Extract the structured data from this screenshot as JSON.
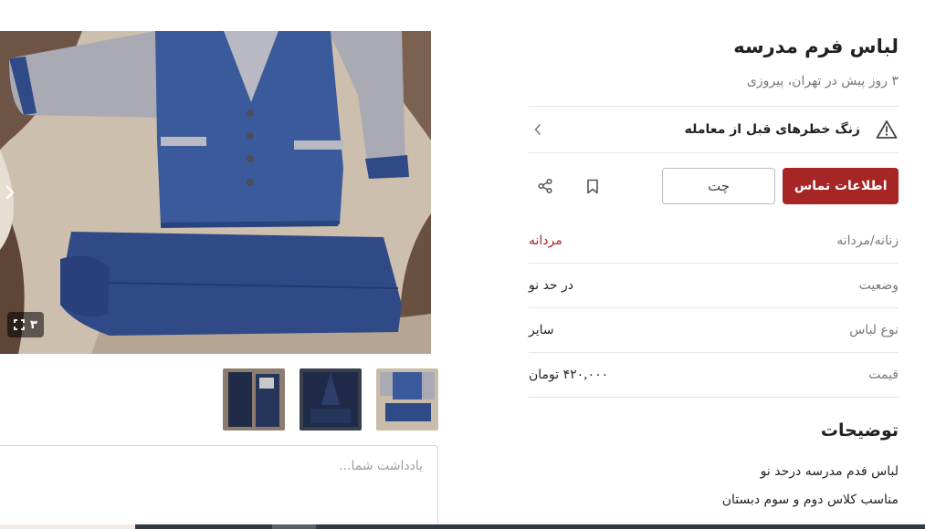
{
  "listing": {
    "title": "لباس فرم مدرسه",
    "subtitle": "۳ روز پیش در تهران، پیروزی"
  },
  "gallery": {
    "photo_count": "۳",
    "thumbnails": [
      "photo-1",
      "photo-2",
      "photo-3"
    ]
  },
  "warning": {
    "text": "زنگ خطرهای قبل از معامله"
  },
  "actions": {
    "contact_label": "اطلاعات تماس",
    "chat_label": "چت"
  },
  "attributes": [
    {
      "label": "زنانه/مردانه",
      "value": "مردانه",
      "accent": true
    },
    {
      "label": "وضعیت",
      "value": "در حد نو",
      "accent": false
    },
    {
      "label": "نوع لباس",
      "value": "سایر",
      "accent": false
    },
    {
      "label": "قیمت",
      "value": "۴۲۰,۰۰۰ تومان",
      "accent": false
    }
  ],
  "description": {
    "heading": "توضیحات",
    "lines": [
      "لباس فدم مدرسه درحد نو",
      "مناسب کلاس دوم و سوم دبستان"
    ]
  },
  "note": {
    "placeholder": "یادداشت شما..."
  },
  "colors": {
    "brand": "#a62626",
    "divider": "#e6e6e6",
    "muted_text": "#7a7a7a"
  },
  "icons": [
    "chevron-right-icon",
    "fullscreen-icon",
    "warning-triangle-icon",
    "chevron-left-icon",
    "bookmark-icon",
    "share-icon"
  ]
}
